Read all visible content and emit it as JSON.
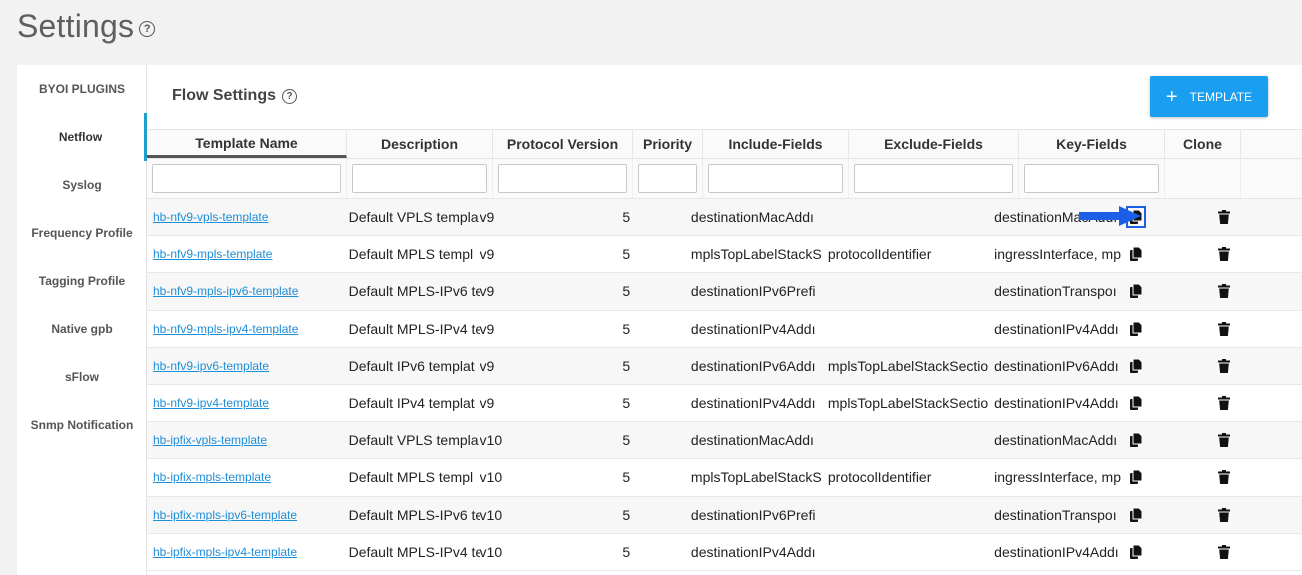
{
  "page": {
    "title": "Settings",
    "help_glyph": "?"
  },
  "sidebar": {
    "items": [
      {
        "label": "BYOI PLUGINS",
        "active": false
      },
      {
        "label": "Netflow",
        "active": true
      },
      {
        "label": "Syslog",
        "active": false
      },
      {
        "label": "Frequency Profile",
        "active": false
      },
      {
        "label": "Tagging Profile",
        "active": false
      },
      {
        "label": "Native gpb",
        "active": false
      },
      {
        "label": "sFlow",
        "active": false
      },
      {
        "label": "Snmp Notification",
        "active": false
      }
    ]
  },
  "section": {
    "title": "Flow Settings",
    "help_glyph": "?"
  },
  "add_button": {
    "plus": "+",
    "label": "TEMPLATE"
  },
  "table": {
    "headers": [
      "Template Name",
      "Description",
      "Protocol Version",
      "Priority",
      "Include-Fields",
      "Exclude-Fields",
      "Key-Fields",
      "Clone"
    ],
    "rows": [
      {
        "name": "hb-nfv9-vpls-template",
        "desc": "Default VPLS templa",
        "version": "v9",
        "priority": "5",
        "include": "destinationMacAddı",
        "exclude": "",
        "key": "destinationMacAddı"
      },
      {
        "name": "hb-nfv9-mpls-template",
        "desc": "Default MPLS templ",
        "version": "v9",
        "priority": "5",
        "include": "mplsTopLabelStackS",
        "exclude": "protocolIdentifier",
        "key": "ingressInterface, mp"
      },
      {
        "name": "hb-nfv9-mpls-ipv6-template",
        "desc": "Default MPLS-IPv6 te",
        "version": "v9",
        "priority": "5",
        "include": "destinationIPv6Prefi",
        "exclude": "",
        "key": "destinationTranspoı"
      },
      {
        "name": "hb-nfv9-mpls-ipv4-template",
        "desc": "Default MPLS-IPv4 te",
        "version": "v9",
        "priority": "5",
        "include": "destinationIPv4Addı",
        "exclude": "",
        "key": "destinationIPv4Addı"
      },
      {
        "name": "hb-nfv9-ipv6-template",
        "desc": "Default IPv6 templat",
        "version": "v9",
        "priority": "5",
        "include": "destinationIPv6Addı",
        "exclude": "mplsTopLabelStackSectio",
        "key": "destinationIPv6Addı"
      },
      {
        "name": "hb-nfv9-ipv4-template",
        "desc": "Default IPv4 templat",
        "version": "v9",
        "priority": "5",
        "include": "destinationIPv4Addı",
        "exclude": "mplsTopLabelStackSectio",
        "key": "destinationIPv4Addı"
      },
      {
        "name": "hb-ipfix-vpls-template",
        "desc": "Default VPLS templa",
        "version": "v10",
        "priority": "5",
        "include": "destinationMacAddı",
        "exclude": "",
        "key": "destinationMacAddı"
      },
      {
        "name": "hb-ipfix-mpls-template",
        "desc": "Default MPLS templ",
        "version": "v10",
        "priority": "5",
        "include": "mplsTopLabelStackS",
        "exclude": "protocolIdentifier",
        "key": "ingressInterface, mp"
      },
      {
        "name": "hb-ipfix-mpls-ipv6-template",
        "desc": "Default MPLS-IPv6 te",
        "version": "v10",
        "priority": "5",
        "include": "destinationIPv6Prefi",
        "exclude": "",
        "key": "destinationTranspoı"
      },
      {
        "name": "hb-ipfix-mpls-ipv4-template",
        "desc": "Default MPLS-IPv4 te",
        "version": "v10",
        "priority": "5",
        "include": "destinationIPv4Addı",
        "exclude": "",
        "key": "destinationIPv4Addı"
      }
    ]
  },
  "colors": {
    "accent": "#1a9ff0",
    "link": "#1d8ed8",
    "active_bar": "#1da1c8",
    "highlight": "#1b5fe6"
  },
  "icons": {
    "copy": "copy-icon",
    "delete": "trash-icon",
    "annotation": "arrow-right-icon"
  }
}
